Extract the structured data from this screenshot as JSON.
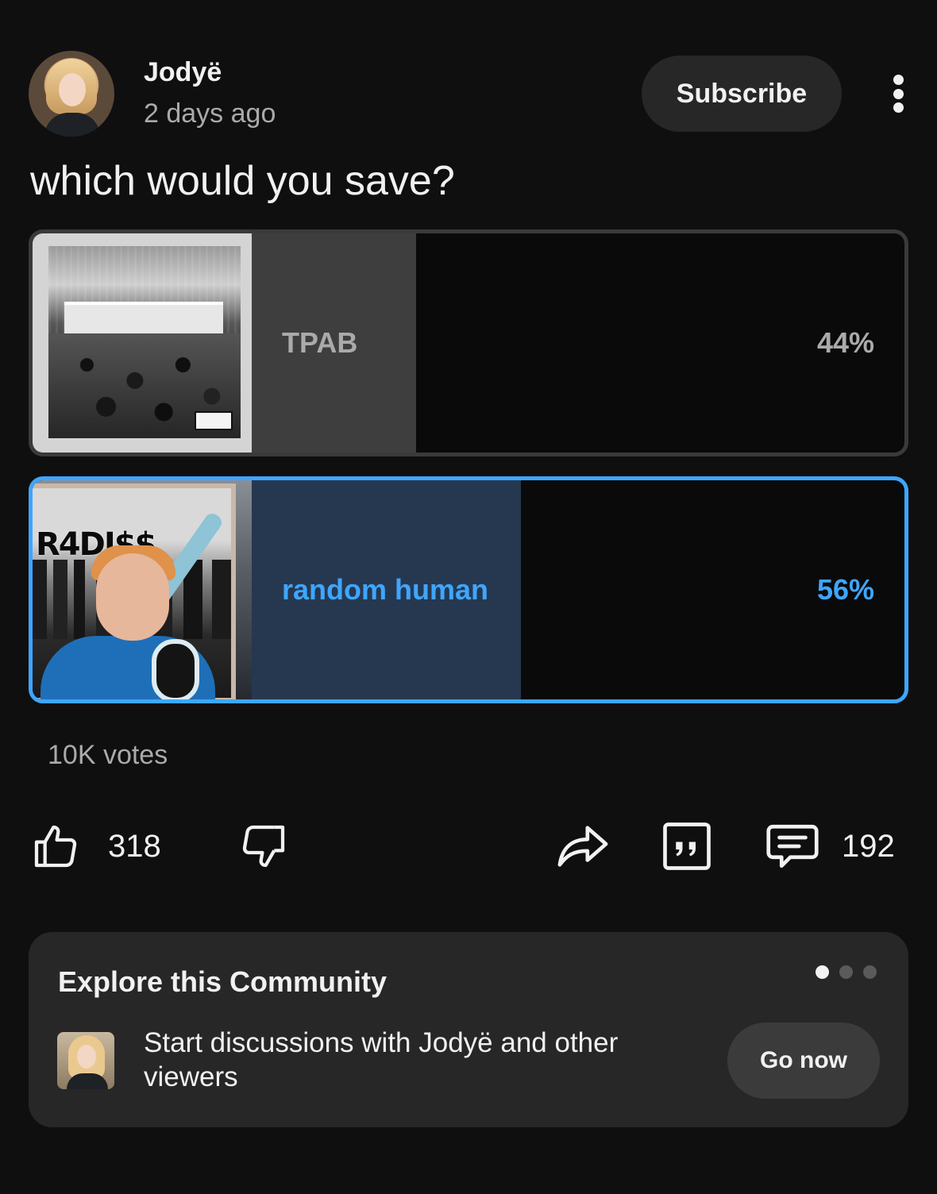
{
  "post": {
    "channel_name": "Jodyë",
    "time": "2 days ago",
    "subscribe_label": "Subscribe",
    "text": "which would you save?"
  },
  "poll": {
    "options": [
      {
        "label": "TPAB",
        "percent_label": "44%",
        "percent": 44,
        "selected": false
      },
      {
        "label": "random human",
        "percent_label": "56%",
        "percent": 56,
        "selected": true
      }
    ],
    "votes": "10K votes"
  },
  "actions": {
    "likes": "318",
    "comments": "192"
  },
  "community": {
    "title": "Explore this Community",
    "description": "Start discussions with Jodyë and other viewers",
    "go_label": "Go now",
    "pager_total": 3,
    "pager_active": 0
  },
  "colors": {
    "accent": "#3ea6ff",
    "background": "#0f0f0f",
    "surface": "#272727"
  },
  "icons": [
    "more-vert-icon",
    "thumb-up-icon",
    "thumb-down-icon",
    "share-icon",
    "quote-icon",
    "comment-icon"
  ]
}
